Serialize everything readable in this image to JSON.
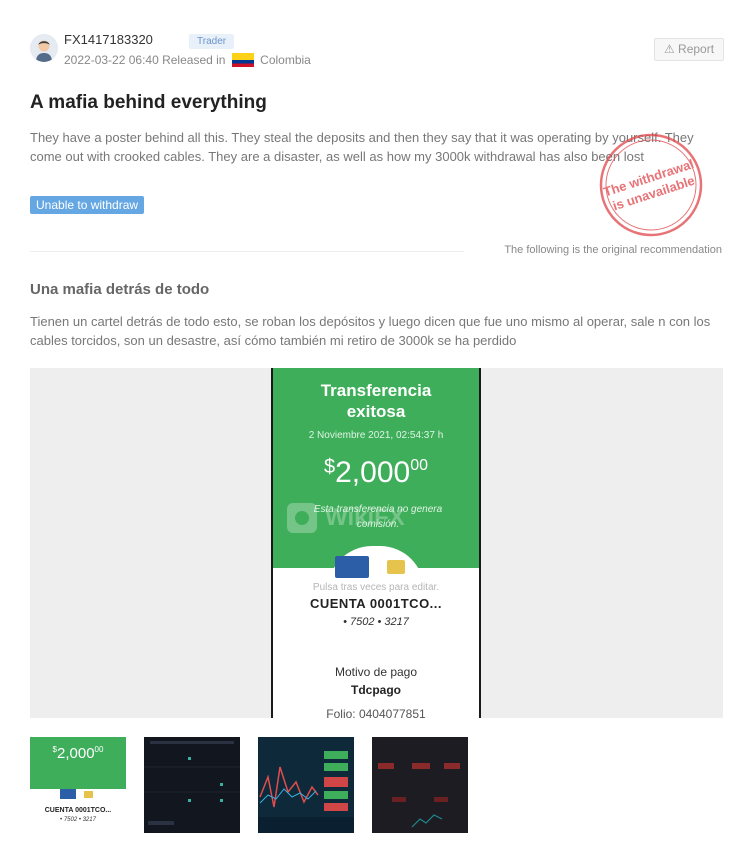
{
  "post": {
    "user_name": "FX1417183320",
    "role": "Trader",
    "date": "2022-03-22 06:40",
    "released_in": "Released in",
    "country": "Colombia",
    "report_label": "⚠ Report",
    "title": "A mafia behind everything",
    "body": "They have a poster behind all this. They steal the deposits and then they say that it was operating by yourself. They come out with crooked cables. They are a disaster, as well as how my 3000k withdrawal has also been lost",
    "tag": "Unable to withdraw",
    "stamp": {
      "line1": "The withdrawal",
      "line2": "is unavailable",
      "color": "#e0454a"
    }
  },
  "original": {
    "note": "The following is the original recommendation",
    "title": "Una mafia detrás de todo",
    "body": "Tienen un cartel detrás de todo esto, se roban los depósitos y luego dicen que fue uno mismo al operar, sale n con los cables torcidos, son un desastre, así cómo también mi retiro de 3000k se ha perdido"
  },
  "screenshot": {
    "title_line1": "Transferencia",
    "title_line2": "exitosa",
    "date": "2  Noviembre 2021, 02:54:37 h",
    "currency": "$",
    "amount": "2,000",
    "cents": "00",
    "note": "Esta transferencia no genera comisión.",
    "watermark": "WikiFX",
    "hint": "Pulsa tras veces para editar.",
    "account": "CUENTA   0001TCO...",
    "acct_nums": "• 7502   •  3217",
    "motivo_label": "Motivo de pago",
    "motivo_value": "Tdcpago",
    "folio": "Folio: 0404077851",
    "accent": "#3fae5b"
  },
  "thumbnails": {
    "t1_currency": "$",
    "t1_amount": "2,000",
    "t1_cents": "00",
    "t1_account": "CUENTA  0001TCO...",
    "t1_nums": "• 7502  •  3217"
  }
}
